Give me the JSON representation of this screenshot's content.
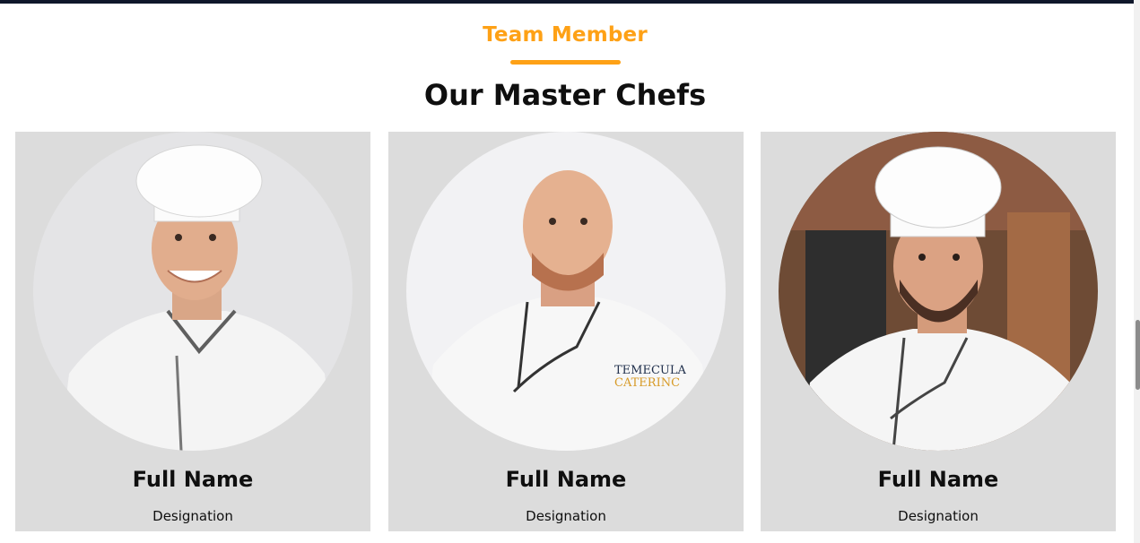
{
  "section": {
    "subtitle": "Team Member",
    "title": "Our Master Chefs",
    "accent_color": "#fea116"
  },
  "team": [
    {
      "name": "Full Name",
      "designation": "Designation",
      "photo_icon": "chef-portrait-1"
    },
    {
      "name": "Full Name",
      "designation": "Designation",
      "photo_icon": "chef-portrait-2",
      "jacket_text_1": "TEMECULA",
      "jacket_text_2": "CATERINC"
    },
    {
      "name": "Full Name",
      "designation": "Designation",
      "photo_icon": "chef-portrait-3"
    }
  ]
}
